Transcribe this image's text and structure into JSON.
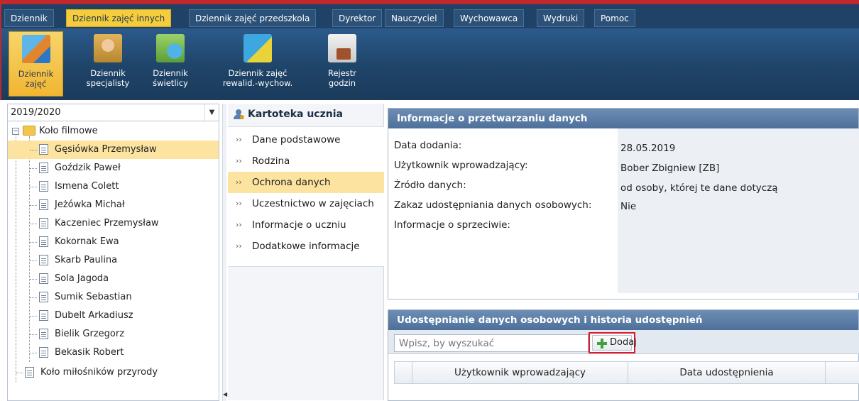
{
  "menu": {
    "tabs": [
      {
        "label": "Dziennik"
      },
      {
        "label": "Dziennik zajęć innych",
        "active": true
      },
      {
        "label": "Dziennik zajęć przedszkola"
      },
      {
        "label": "Dyrektor"
      },
      {
        "label": "Nauczyciel"
      },
      {
        "label": "Wychowawca"
      },
      {
        "label": "Wydruki"
      },
      {
        "label": "Pomoc"
      }
    ]
  },
  "ribbon": {
    "buttons": [
      {
        "line1": "Dziennik",
        "line2": "zajęć",
        "icon": "journal-chart-icon",
        "active": true
      },
      {
        "line1": "Dziennik",
        "line2": "specjalisty",
        "icon": "specialist-person-icon"
      },
      {
        "line1": "Dziennik",
        "line2": "świetlicy",
        "icon": "common-room-clock-icon"
      },
      {
        "line1": "Dziennik zajęć",
        "line2": "rewalid.-wychow.",
        "icon": "revalidation-journal-icon"
      },
      {
        "line1": "Rejestr",
        "line2": "godzin",
        "icon": "hours-register-briefcase-icon"
      }
    ]
  },
  "left_panel": {
    "year": "2019/2020",
    "groups": [
      {
        "name": "Koło filmowe",
        "expanded": true,
        "students": [
          "Gęsiówka Przemysław",
          "Goździk Paweł",
          "Ismena Colett",
          "Jeżówka Michał",
          "Kaczeniec Przemysław",
          "Kokornak Ewa",
          "Skarb Paulina",
          "Sola Jagoda",
          "Sumik Sebastian",
          "Dubelt Arkadiusz",
          "Bielik Grzegorz",
          "Bekasik Robert"
        ],
        "selected": "Gęsiówka Przemysław"
      },
      {
        "name": "Koło miłośników przyrody",
        "expanded": false
      }
    ]
  },
  "student_card": {
    "title": "Kartoteka ucznia",
    "items": [
      {
        "label": "Dane podstawowe"
      },
      {
        "label": "Rodzina"
      },
      {
        "label": "Ochrona danych",
        "active": true
      },
      {
        "label": "Uczestnictwo w zajęciach"
      },
      {
        "label": "Informacje o uczniu"
      },
      {
        "label": "Dodatkowe informacje"
      }
    ]
  },
  "processing_info": {
    "title": "Informacje o przetwarzaniu danych",
    "fields": [
      {
        "label": "Data dodania:",
        "value": "28.05.2019"
      },
      {
        "label": "Użytkownik wprowadzający:",
        "value": "Bober Zbigniew [ZB]"
      },
      {
        "label": "Źródło danych:",
        "value": "od osoby, której te dane dotyczą"
      },
      {
        "label": "Zakaz udostępniania danych osobowych:",
        "value": "Nie"
      },
      {
        "label": "Informacje o sprzeciwie:",
        "value": ""
      }
    ]
  },
  "sharing": {
    "title": "Udostępnianie danych osobowych i historia udostępnień",
    "search_placeholder": "Wpisz, by wyszukać",
    "add_label": "Dodaj",
    "columns": [
      "Użytkownik wprowadzający",
      "Data udostępnienia"
    ]
  },
  "colors": {
    "accent_yellow": "#f5cd3c",
    "selection": "#fce3a0",
    "header_blue": "#1f4266",
    "highlight_red": "#e0182a"
  }
}
